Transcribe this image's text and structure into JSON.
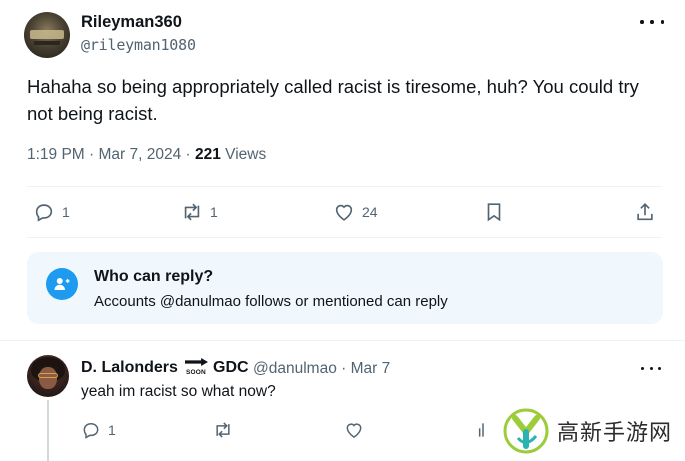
{
  "tweet": {
    "author_name": "Rileyman360",
    "author_handle": "@rileyman1080",
    "text": "Hahaha so being appropriately called racist is tiresome, huh? You could try not being racist.",
    "time": "1:19 PM · Mar 7, 2024 · ",
    "views_count": "221",
    "views_label": " Views",
    "replies": "1",
    "retweets": "1",
    "likes": "24"
  },
  "reply_notice": {
    "title": "Who can reply?",
    "description": "Accounts @danulmao follows or mentioned can reply"
  },
  "reply": {
    "author_name": "D. Lalonders",
    "badge_text": "SOON",
    "badge_suffix": "GDC",
    "handle_date": "@danulmao · Mar 7",
    "text": "yeah im racist so what now?",
    "replies": "1"
  },
  "watermark": {
    "text": "高新手游网"
  },
  "icons": [
    "more-icon",
    "reply-icon",
    "retweet-icon",
    "like-icon",
    "bookmark-icon",
    "share-icon",
    "people-icon",
    "analytics-icon"
  ],
  "colors": {
    "accent": "#1d9bf0",
    "muted": "#536471",
    "text": "#0f1419",
    "notice_bg": "#f0f8fd"
  }
}
